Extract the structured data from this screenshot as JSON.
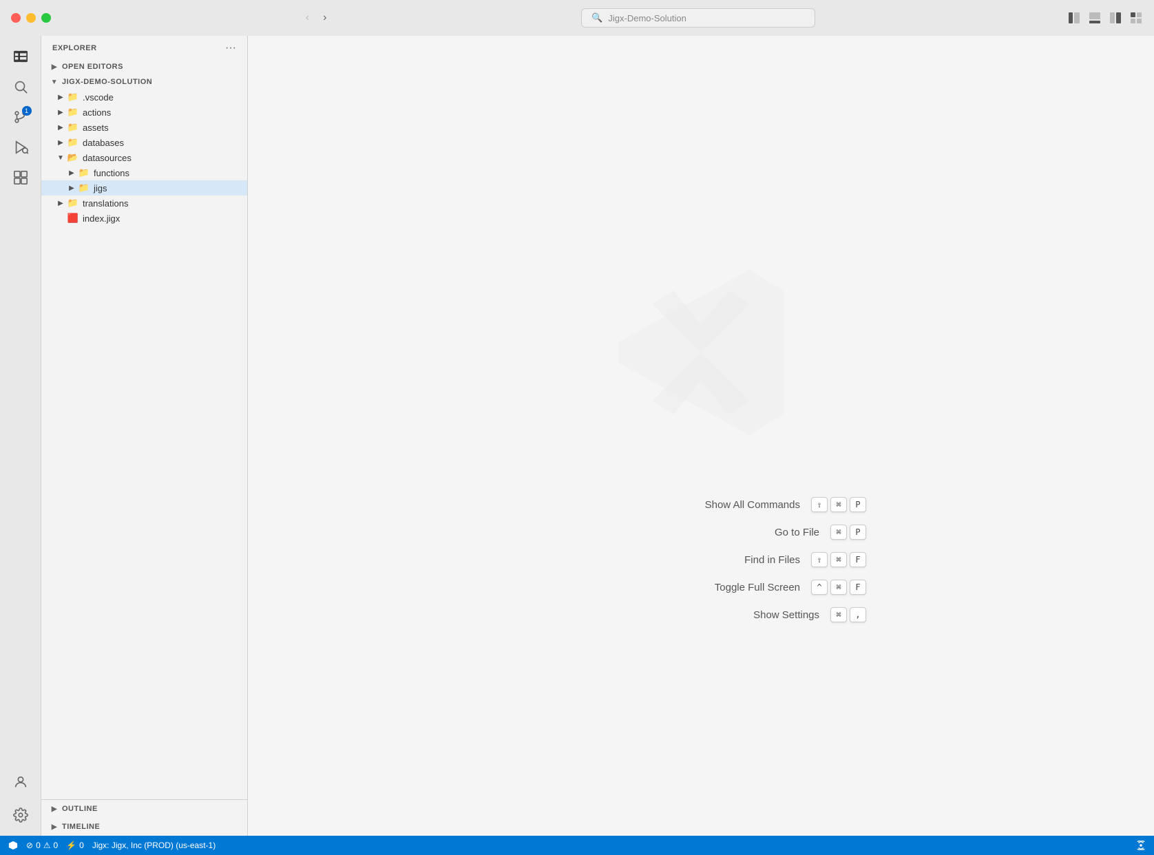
{
  "titlebar": {
    "search_placeholder": "Jigx-Demo-Solution",
    "back_label": "←",
    "forward_label": "→"
  },
  "sidebar": {
    "title": "EXPLORER",
    "more_label": "···",
    "sections": {
      "open_editors": "OPEN EDITORS",
      "project": "JIGX-DEMO-SOLUTION"
    },
    "tree_items": [
      {
        "name": ".vscode",
        "type": "folder",
        "collapsed": true,
        "indent": 1
      },
      {
        "name": "actions",
        "type": "folder",
        "collapsed": true,
        "indent": 1
      },
      {
        "name": "assets",
        "type": "folder",
        "collapsed": true,
        "indent": 1
      },
      {
        "name": "databases",
        "type": "folder",
        "collapsed": true,
        "indent": 1
      },
      {
        "name": "datasources",
        "type": "folder",
        "collapsed": false,
        "indent": 1
      },
      {
        "name": "functions",
        "type": "folder",
        "collapsed": true,
        "indent": 2
      },
      {
        "name": "jigs",
        "type": "folder",
        "collapsed": true,
        "indent": 2,
        "selected": true
      },
      {
        "name": "translations",
        "type": "folder",
        "collapsed": true,
        "indent": 1
      },
      {
        "name": "index.jigx",
        "type": "file",
        "indent": 1
      }
    ],
    "outline": "OUTLINE",
    "timeline": "TIMELINE"
  },
  "activity_bar": {
    "items": [
      {
        "name": "explorer",
        "label": "Explorer",
        "active": true
      },
      {
        "name": "search",
        "label": "Search"
      },
      {
        "name": "source-control",
        "label": "Source Control",
        "badge": "1"
      },
      {
        "name": "run-debug",
        "label": "Run and Debug"
      },
      {
        "name": "extensions",
        "label": "Extensions"
      }
    ],
    "bottom_items": [
      {
        "name": "accounts",
        "label": "Accounts"
      },
      {
        "name": "settings",
        "label": "Settings"
      }
    ]
  },
  "editor": {
    "shortcuts": [
      {
        "label": "Show All Commands",
        "keys": [
          "⇧",
          "⌘",
          "P"
        ]
      },
      {
        "label": "Go to File",
        "keys": [
          "⌘",
          "P"
        ]
      },
      {
        "label": "Find in Files",
        "keys": [
          "⇧",
          "⌘",
          "F"
        ]
      },
      {
        "label": "Toggle Full Screen",
        "keys": [
          "^",
          "⌘",
          "F"
        ]
      },
      {
        "label": "Show Settings",
        "keys": [
          "⌘",
          ","
        ]
      }
    ]
  },
  "status_bar": {
    "error_icon": "⊘",
    "error_count": "0",
    "warning_icon": "⚠",
    "warning_count": "0",
    "remote_icon": "⚡",
    "remote_count": "0",
    "environment": "Jigx: Jigx, Inc (PROD) (us-east-1)",
    "broadcast_icon": "📡"
  }
}
